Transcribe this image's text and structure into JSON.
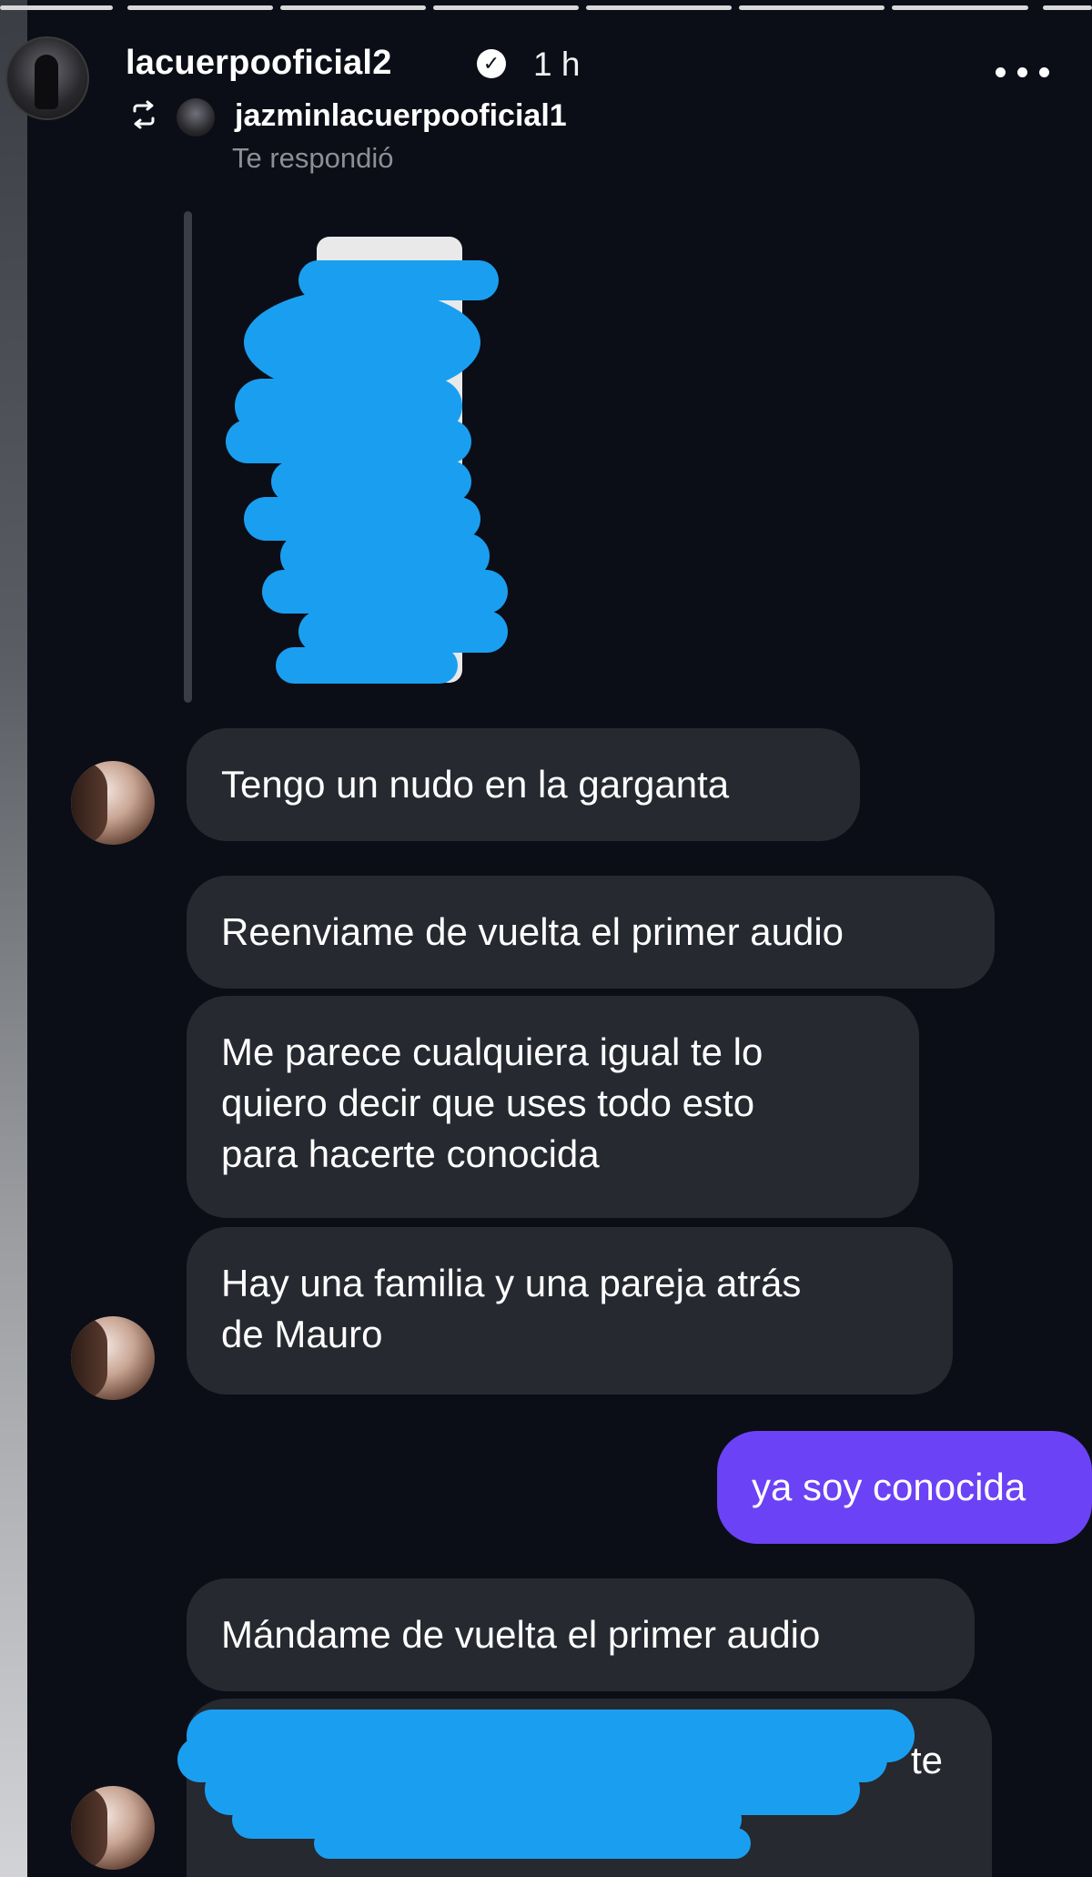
{
  "story": {
    "username": "lacuerpooficial2",
    "verified_icon": "verified-badge-icon",
    "time": "1 h",
    "more_icon": "more-options-icon",
    "repost": {
      "icon": "repost-icon",
      "username": "jazminlacuerpooficial1"
    },
    "reply_label": "Te respondió"
  },
  "messages": [
    {
      "direction": "in",
      "text": "Tengo un nudo en la garganta"
    },
    {
      "direction": "in",
      "text": "Reenviame de vuelta el primer audio"
    },
    {
      "direction": "in",
      "lines": [
        "Me parece cualquiera igual te lo",
        "quiero decir que uses todo esto",
        "para hacerte conocida"
      ]
    },
    {
      "direction": "in",
      "lines": [
        "Hay una familia y una pareja atrás",
        "de Mauro"
      ]
    },
    {
      "direction": "out",
      "text": "ya soy conocida"
    },
    {
      "direction": "in",
      "text": "Mándame de vuelta el primer audio"
    },
    {
      "direction": "in",
      "visible_fragment": "te",
      "redacted": true
    }
  ],
  "colors": {
    "background": "#0b0e17",
    "incoming_bubble": "#262930",
    "outgoing_bubble": "#6b42f5",
    "redaction": "#1a9ff0",
    "secondary_text": "#8e8f96"
  }
}
